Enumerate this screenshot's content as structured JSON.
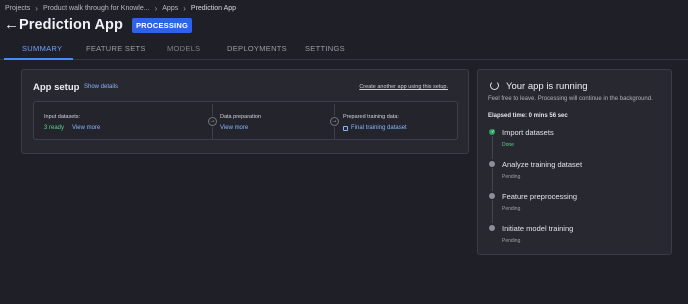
{
  "breadcrumb": [
    "Projects",
    "Product walk through for Knowle...",
    "Apps",
    "Prediction App"
  ],
  "header": {
    "back_glyph": "←",
    "title": "Prediction App",
    "status_badge": "PROCESSING"
  },
  "tabs": [
    "SUMMARY",
    "FEATURE SETS",
    "MODELS",
    "DEPLOYMENTS",
    "SETTINGS"
  ],
  "active_tab": "SUMMARY",
  "app_setup": {
    "title": "App setup",
    "show_details": "Show details",
    "create_link": "Create another app using this setup.",
    "steps": {
      "input": {
        "label": "Input datasets:",
        "count": "3 ready",
        "link": "View more"
      },
      "prep": {
        "label": "Data preparation",
        "link": "View more"
      },
      "training": {
        "label": "Prepared training data:",
        "link": "Final training dataset"
      }
    }
  },
  "running_panel": {
    "title": "Your app is running",
    "subtitle": "Feel free to leave. Processing will continue in the background.",
    "elapsed": "Elapsed time: 0 mins 56 sec",
    "tasks": [
      {
        "name": "Import datasets",
        "status": "Done"
      },
      {
        "name": "Analyze training dataset",
        "status": "Pending"
      },
      {
        "name": "Feature preprocessing",
        "status": "Pending"
      },
      {
        "name": "Initiate model training",
        "status": "Pending"
      }
    ]
  },
  "colors": {
    "background": "#1f2027",
    "accent": "#4d8af7",
    "badge": "#2f62e6",
    "success": "#5bd38c"
  }
}
